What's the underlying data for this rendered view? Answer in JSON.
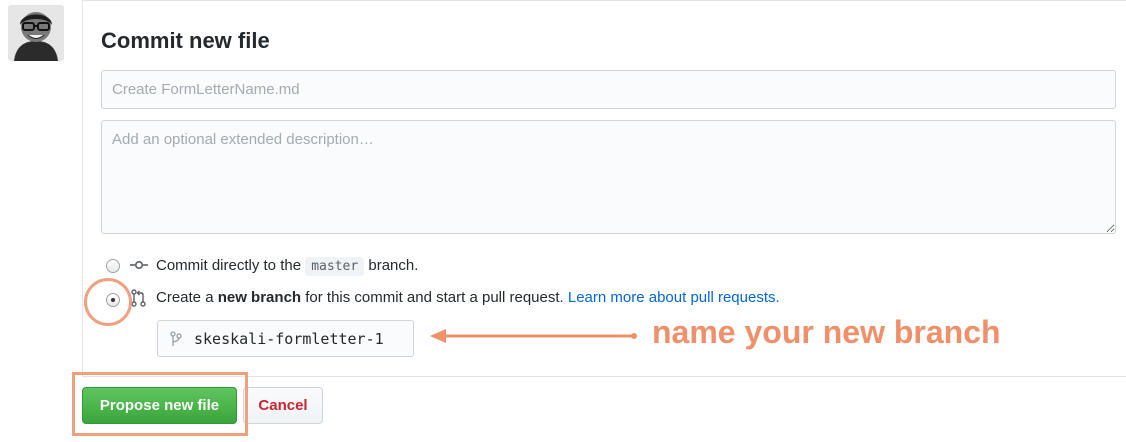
{
  "form": {
    "title": "Commit new file",
    "summary_placeholder": "Create FormLetterName.md",
    "description_placeholder": "Add an optional extended description…"
  },
  "options": {
    "direct": {
      "prefix": "Commit directly to the",
      "branch": "master",
      "suffix": "branch.",
      "selected": false,
      "icon": "commit-icon"
    },
    "new_branch": {
      "prefix": "Create a",
      "bold": "new branch",
      "suffix": "for this commit and start a pull request.",
      "link": "Learn more about pull requests.",
      "selected": true,
      "icon": "pull-request-icon"
    }
  },
  "branch_name": {
    "value": "skeskali-formletter-1",
    "icon": "branch-icon"
  },
  "annotations": {
    "label": "name your new branch",
    "color": "#f0906a"
  },
  "buttons": {
    "propose": "Propose new file",
    "cancel": "Cancel"
  },
  "colors": {
    "primary_button": "#3aa53a",
    "cancel_text": "#cb2431",
    "link": "#0366d6"
  }
}
